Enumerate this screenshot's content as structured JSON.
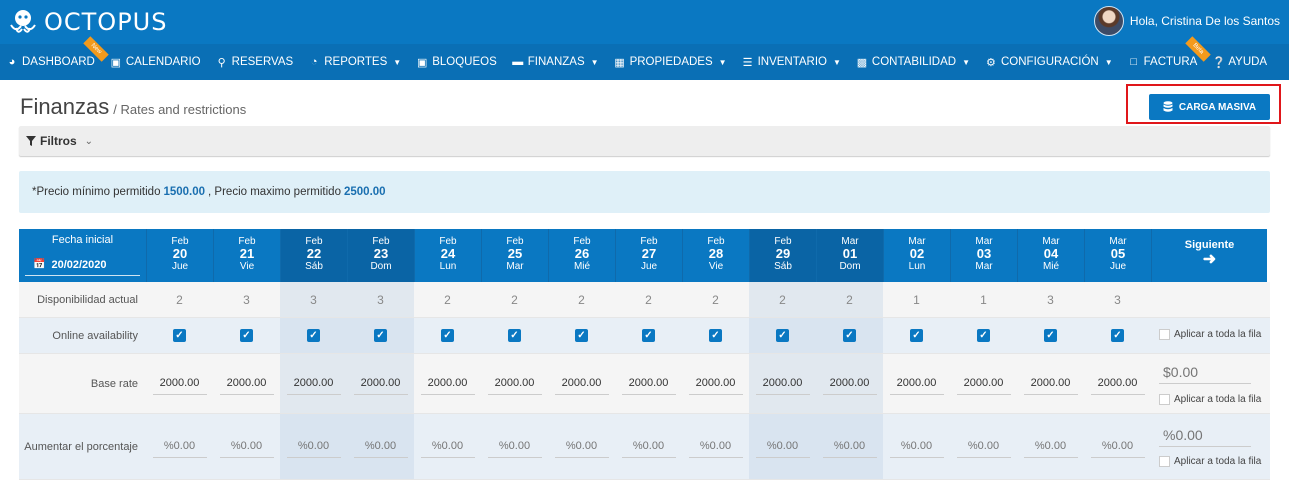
{
  "brand": {
    "name": "OCTOPUS",
    "accent": "#0a78c2"
  },
  "user": {
    "greeting": "Hola, Cristina De los Santos"
  },
  "nav": [
    {
      "label": "DASHBOARD",
      "icon": "dashboard-icon",
      "ribbon": "New",
      "caret": false
    },
    {
      "label": "CALENDARIO",
      "icon": "calendar-icon",
      "caret": false
    },
    {
      "label": "RESERVAS",
      "icon": "search-icon",
      "caret": false
    },
    {
      "label": "REPORTES",
      "icon": "pie-chart-icon",
      "caret": true
    },
    {
      "label": "BLOQUEOS",
      "icon": "lock-icon",
      "caret": false
    },
    {
      "label": "FINANZAS",
      "icon": "folder-icon",
      "caret": true
    },
    {
      "label": "PROPIEDADES",
      "icon": "map-icon",
      "caret": true
    },
    {
      "label": "INVENTARIO",
      "icon": "list-icon",
      "caret": true
    },
    {
      "label": "CONTABILIDAD",
      "icon": "calculator-icon",
      "caret": true
    },
    {
      "label": "CONFIGURACIÓN",
      "icon": "gear-icon",
      "caret": true
    },
    {
      "label": "FACTURA",
      "icon": "file-icon",
      "ribbon": "Beta",
      "caret": false
    },
    {
      "label": "AYUDA",
      "icon": "help-icon",
      "caret": false
    }
  ],
  "page": {
    "title": "Finanzas",
    "subtitle": "/ Rates and restrictions"
  },
  "carga_button": "CARGA MASIVA",
  "filters": {
    "label": "Filtros"
  },
  "alert": {
    "prefix": "*Precio mínimo permitido",
    "min": "1500.00",
    "middle": ", Precio maximo permitido",
    "max": "2500.00"
  },
  "grid": {
    "start_label": "Fecha inicial",
    "start_date": "20/02/2020",
    "next_label": "Siguiente",
    "days": [
      {
        "month": "Feb",
        "num": "20",
        "name": "Jue",
        "weekend": false
      },
      {
        "month": "Feb",
        "num": "21",
        "name": "Vie",
        "weekend": false
      },
      {
        "month": "Feb",
        "num": "22",
        "name": "Sáb",
        "weekend": true
      },
      {
        "month": "Feb",
        "num": "23",
        "name": "Dom",
        "weekend": true
      },
      {
        "month": "Feb",
        "num": "24",
        "name": "Lun",
        "weekend": false
      },
      {
        "month": "Feb",
        "num": "25",
        "name": "Mar",
        "weekend": false
      },
      {
        "month": "Feb",
        "num": "26",
        "name": "Mié",
        "weekend": false
      },
      {
        "month": "Feb",
        "num": "27",
        "name": "Jue",
        "weekend": false
      },
      {
        "month": "Feb",
        "num": "28",
        "name": "Vie",
        "weekend": false
      },
      {
        "month": "Feb",
        "num": "29",
        "name": "Sáb",
        "weekend": true
      },
      {
        "month": "Mar",
        "num": "01",
        "name": "Dom",
        "weekend": true
      },
      {
        "month": "Mar",
        "num": "02",
        "name": "Lun",
        "weekend": false
      },
      {
        "month": "Mar",
        "num": "03",
        "name": "Mar",
        "weekend": false
      },
      {
        "month": "Mar",
        "num": "04",
        "name": "Mié",
        "weekend": false
      },
      {
        "month": "Mar",
        "num": "05",
        "name": "Jue",
        "weekend": false
      }
    ],
    "rows": {
      "availability": {
        "label": "Disponibilidad actual",
        "values": [
          "2",
          "3",
          "3",
          "3",
          "2",
          "2",
          "2",
          "2",
          "2",
          "2",
          "2",
          "1",
          "1",
          "3",
          "3"
        ]
      },
      "online": {
        "label": "Online availability",
        "checked": true,
        "apply_label": "Aplicar a toda la fila"
      },
      "base_rate": {
        "label": "Base rate",
        "values": [
          "2000.00",
          "2000.00",
          "2000.00",
          "2000.00",
          "2000.00",
          "2000.00",
          "2000.00",
          "2000.00",
          "2000.00",
          "2000.00",
          "2000.00",
          "2000.00",
          "2000.00",
          "2000.00",
          "2000.00"
        ],
        "bulk_placeholder": "$0.00",
        "apply_label": "Aplicar a toda la fila"
      },
      "increase_pct": {
        "label": "Aumentar el porcentaje",
        "placeholder": "%0.00",
        "bulk_placeholder": "%0.00",
        "apply_label": "Aplicar a toda la fila"
      }
    }
  }
}
